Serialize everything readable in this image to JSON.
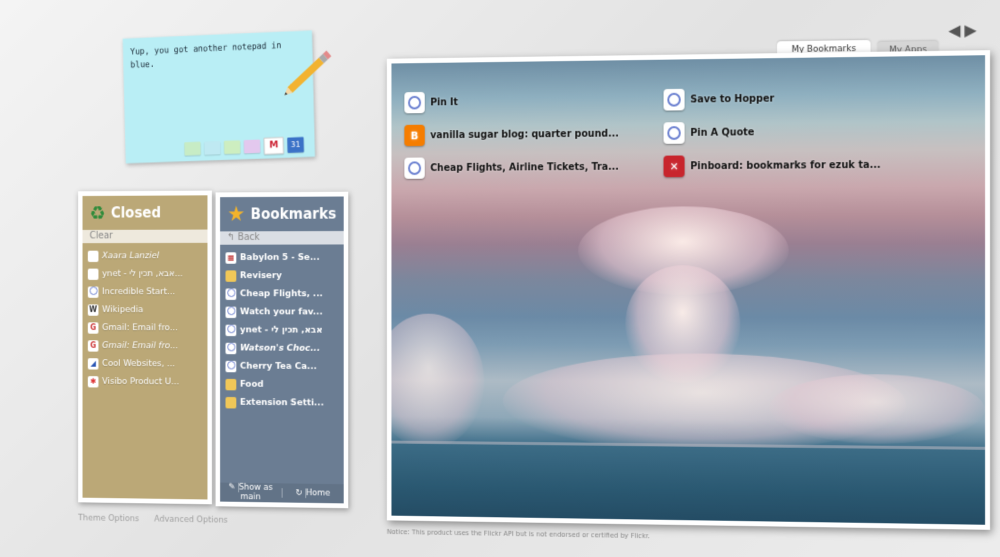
{
  "note": {
    "text": "Yup, you got another notepad in blue.",
    "colors": [
      "#c7ecc5",
      "#bfe9f2",
      "#cdeec0",
      "#e3c8ee"
    ],
    "calendar_label": "31"
  },
  "closed_panel": {
    "title": "Closed",
    "clear_label": "Clear",
    "items": [
      {
        "label": "Xaara Lanziel",
        "icon": "page-icon"
      },
      {
        "label": "ynet - אבא, תכין לי...",
        "icon": "page-icon"
      },
      {
        "label": "Incredible Start...",
        "icon": "globe-icon"
      },
      {
        "label": "Wikipedia",
        "icon": "wikipedia-icon"
      },
      {
        "label": "Gmail: Email fro...",
        "icon": "gmail-icon"
      },
      {
        "label": "Gmail: Email fro...",
        "icon": "gmail-icon"
      },
      {
        "label": "Cool Websites, ...",
        "icon": "site-icon"
      },
      {
        "label": "Visibo Product U...",
        "icon": "visibo-icon"
      }
    ]
  },
  "bookmarks_panel": {
    "title": "Bookmarks",
    "back_label": "Back",
    "items": [
      {
        "label": "Babylon 5 - Se...",
        "icon": "site-icon"
      },
      {
        "label": "Revisery",
        "icon": "folder-icon"
      },
      {
        "label": "Cheap Flights, ...",
        "icon": "globe-icon"
      },
      {
        "label": "Watch your fav...",
        "icon": "globe-icon"
      },
      {
        "label": "ynet - אבא, תכין לי",
        "icon": "globe-icon"
      },
      {
        "label": "Watson's Choc...",
        "icon": "globe-icon"
      },
      {
        "label": "Cherry Tea Ca...",
        "icon": "globe-icon"
      },
      {
        "label": "Food",
        "icon": "folder-icon"
      },
      {
        "label": "Extension Setti...",
        "icon": "folder-icon"
      }
    ],
    "footer_show": "Show as main",
    "footer_home": "Home"
  },
  "options": {
    "theme": "Theme Options",
    "advanced": "Advanced Options"
  },
  "notice": "Notice: This product uses the Flickr API but is not endorsed or certified by Flickr.",
  "tabs": {
    "my_bookmarks": "My Bookmarks",
    "my_apps": "My Apps"
  },
  "speed_dial": {
    "left": [
      {
        "label": "Pin It",
        "icon": "globe-icon"
      },
      {
        "label": "vanilla sugar blog: quarter pound...",
        "icon": "blogger-icon"
      },
      {
        "label": "Cheap Flights, Airline Tickets, Tra...",
        "icon": "globe-icon"
      }
    ],
    "right": [
      {
        "label": "Save to Hopper",
        "icon": "globe-icon"
      },
      {
        "label": "Pin A Quote",
        "icon": "globe-icon"
      },
      {
        "label": "Pinboard: bookmarks for ezuk ta...",
        "icon": "pinboard-icon"
      }
    ]
  }
}
